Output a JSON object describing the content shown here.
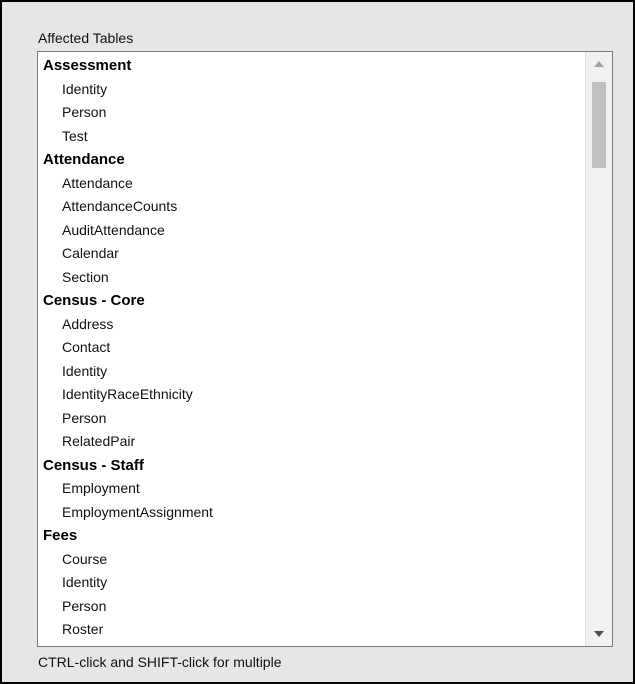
{
  "panel": {
    "title": "Affected Tables",
    "hint": "CTRL-click and SHIFT-click for multiple"
  },
  "list": {
    "groups": [
      {
        "label": "Assessment",
        "items": [
          "Identity",
          "Person",
          "Test"
        ]
      },
      {
        "label": "Attendance",
        "items": [
          "Attendance",
          "AttendanceCounts",
          "AuditAttendance",
          "Calendar",
          "Section"
        ]
      },
      {
        "label": "Census - Core",
        "items": [
          "Address",
          "Contact",
          "Identity",
          "IdentityRaceEthnicity",
          "Person",
          "RelatedPair"
        ]
      },
      {
        "label": "Census - Staff",
        "items": [
          "Employment",
          "EmploymentAssignment"
        ]
      },
      {
        "label": "Fees",
        "items": [
          "Course",
          "Identity",
          "Person",
          "Roster"
        ]
      }
    ]
  },
  "scrollbar": {
    "up_icon": "triangle-up-icon",
    "down_icon": "triangle-down-icon",
    "color": "#c1c1c1"
  }
}
